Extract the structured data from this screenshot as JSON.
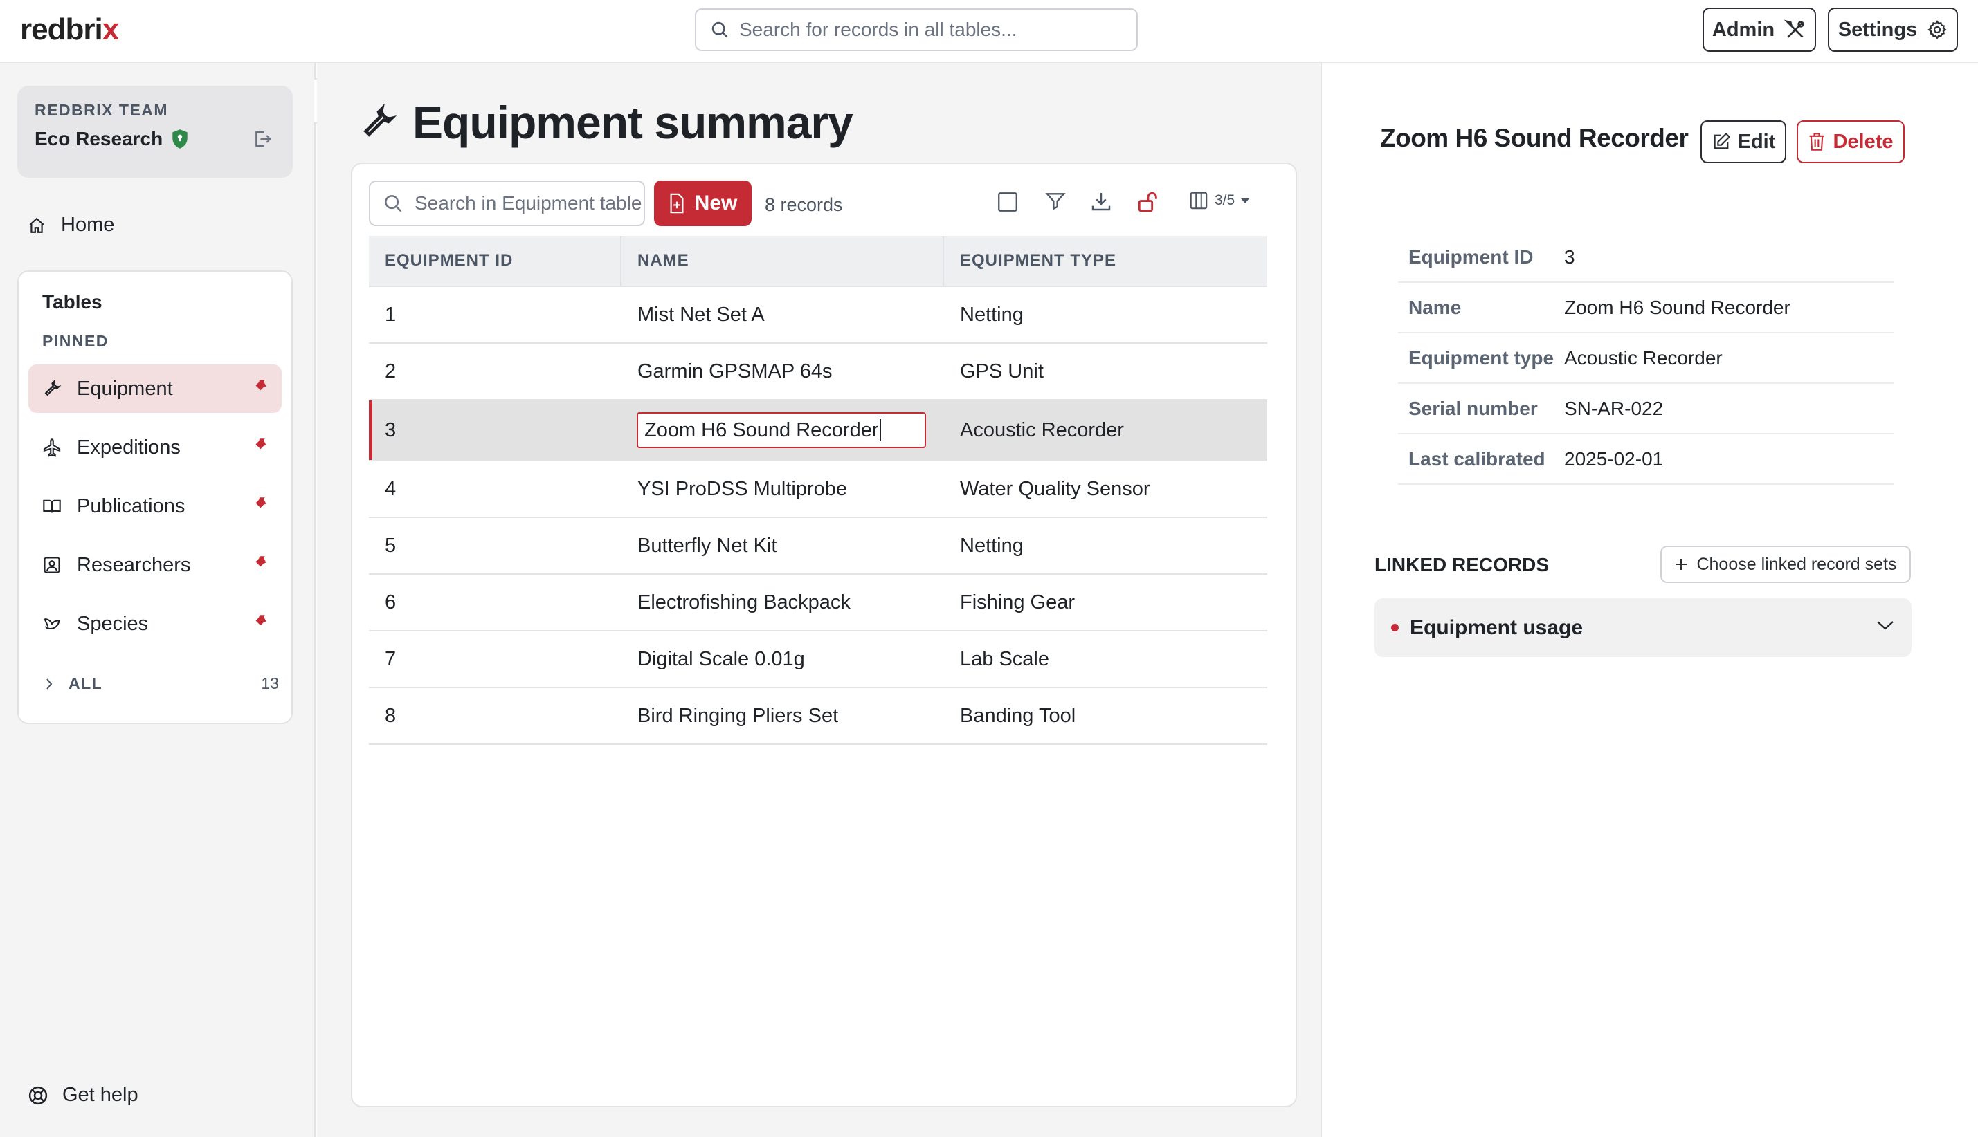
{
  "brand": {
    "name_main": "redbri",
    "name_accent": "x",
    "accent_color": "#c42b34"
  },
  "header": {
    "search_placeholder": "Search for records in all tables...",
    "admin_label": "Admin",
    "settings_label": "Settings"
  },
  "sidebar": {
    "team_label": "REDBRIX TEAM",
    "team_name": "Eco Research",
    "home_label": "Home",
    "tables_title": "Tables",
    "pinned_label": "PINNED",
    "items": [
      {
        "label": "Equipment",
        "icon": "wrench-icon",
        "active": true
      },
      {
        "label": "Expeditions",
        "icon": "plane-icon"
      },
      {
        "label": "Publications",
        "icon": "book-icon"
      },
      {
        "label": "Researchers",
        "icon": "id-badge-icon"
      },
      {
        "label": "Species",
        "icon": "bird-icon"
      }
    ],
    "all_label": "ALL",
    "all_count": "13",
    "help_label": "Get help"
  },
  "main": {
    "title": "Equipment summary",
    "search_placeholder": "Search in Equipment table",
    "new_label": "New",
    "record_count": "8 records",
    "columns_indicator": "3/5",
    "columns": [
      "EQUIPMENT ID",
      "NAME",
      "EQUIPMENT TYPE"
    ],
    "rows": [
      {
        "id": "1",
        "name": "Mist Net Set A",
        "type": "Netting"
      },
      {
        "id": "2",
        "name": "Garmin GPSMAP 64s",
        "type": "GPS Unit"
      },
      {
        "id": "3",
        "name": "Zoom H6 Sound Recorder",
        "type": "Acoustic Recorder",
        "selected": true,
        "editing_value": "Zoom H6 Sound Recorder"
      },
      {
        "id": "4",
        "name": "YSI ProDSS Multiprobe",
        "type": "Water Quality Sensor"
      },
      {
        "id": "5",
        "name": "Butterfly Net Kit",
        "type": "Netting"
      },
      {
        "id": "6",
        "name": "Electrofishing Backpack",
        "type": "Fishing Gear"
      },
      {
        "id": "7",
        "name": "Digital Scale 0.01g",
        "type": "Lab Scale"
      },
      {
        "id": "8",
        "name": "Bird Ringing Pliers Set",
        "type": "Banding Tool"
      }
    ]
  },
  "detail": {
    "title": "Zoom H6 Sound Recorder",
    "edit_label": "Edit",
    "delete_label": "Delete",
    "fields": [
      {
        "key": "Equipment ID",
        "value": "3"
      },
      {
        "key": "Name",
        "value": "Zoom H6 Sound Recorder"
      },
      {
        "key": "Equipment type",
        "value": "Acoustic Recorder"
      },
      {
        "key": "Serial number",
        "value": "SN-AR-022"
      },
      {
        "key": "Last calibrated",
        "value": "2025-02-01"
      }
    ],
    "linked_label": "LINKED RECORDS",
    "choose_label": "Choose linked record sets",
    "linked_sets": [
      {
        "label": "Equipment usage"
      }
    ]
  }
}
